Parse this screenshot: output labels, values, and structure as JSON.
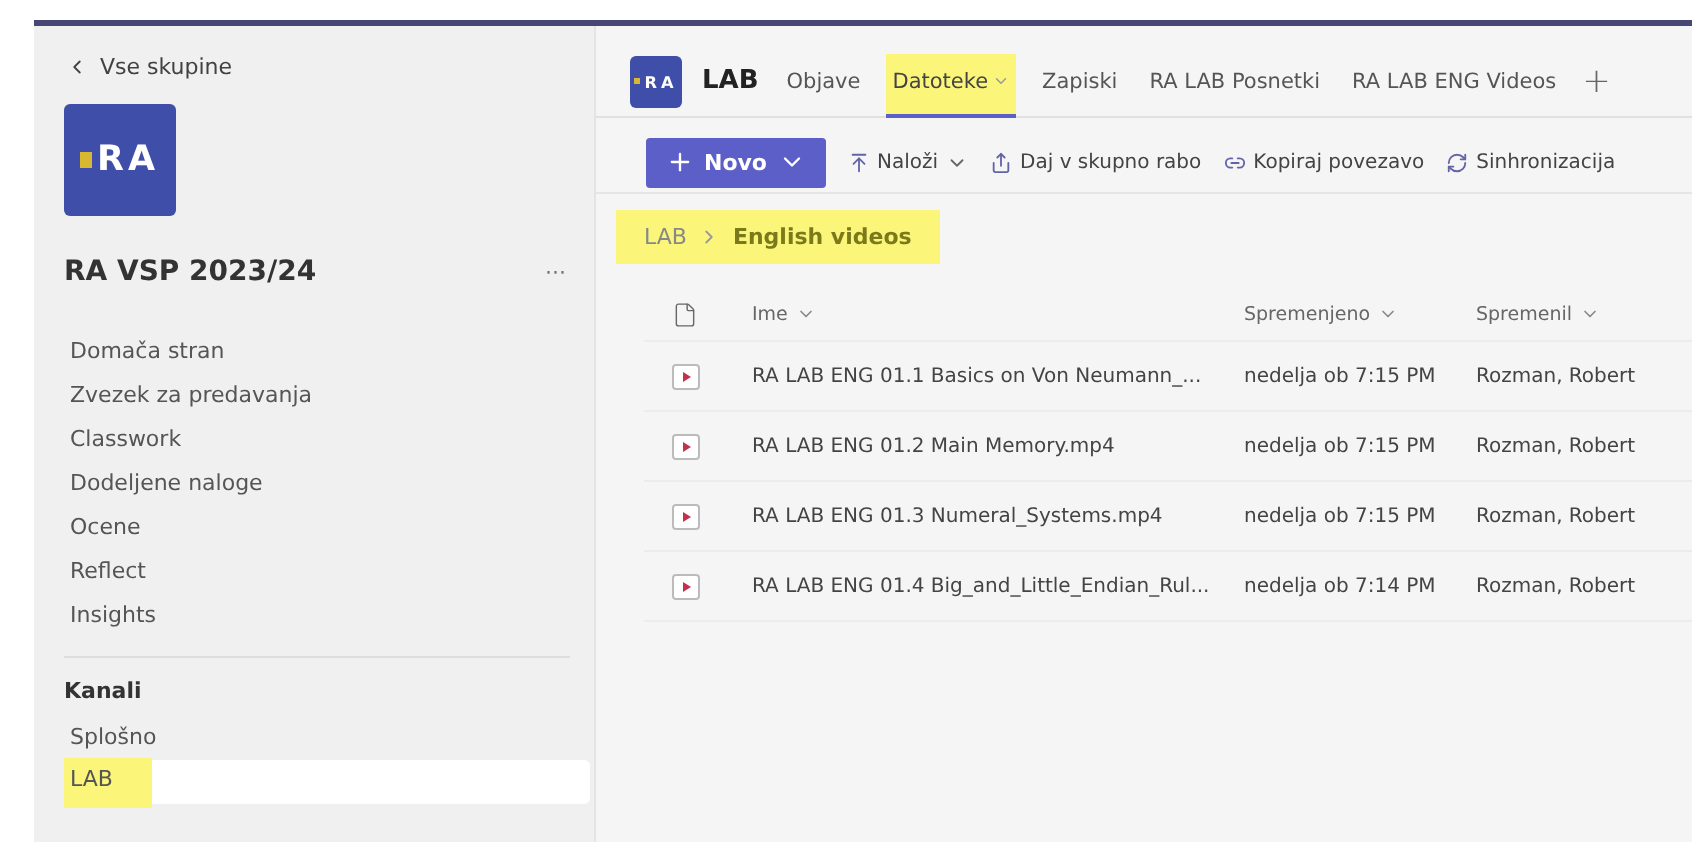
{
  "sidebar": {
    "back_label": "Vse skupine",
    "team_logo": "RA",
    "team_name": "RA VSP 2023/24",
    "more": "···",
    "items": [
      {
        "label": "Domača stran",
        "selected": false
      },
      {
        "label": "Zvezek za predavanja",
        "selected": false
      },
      {
        "label": "Classwork",
        "selected": false
      },
      {
        "label": "Dodeljene naloge",
        "selected": false
      },
      {
        "label": "Ocene",
        "selected": false
      },
      {
        "label": "Reflect",
        "selected": false
      },
      {
        "label": "Insights",
        "selected": false
      }
    ],
    "channels_heading": "Kanali",
    "channels": [
      {
        "label": "Splošno",
        "selected": false,
        "highlighted": false
      },
      {
        "label": "LAB",
        "selected": true,
        "highlighted": true
      }
    ]
  },
  "header": {
    "logo": "RA",
    "channel": "LAB",
    "tabs": [
      {
        "label": "Objave",
        "selected": false,
        "highlighted": false,
        "dropdown": false
      },
      {
        "label": "Datoteke",
        "selected": true,
        "highlighted": true,
        "dropdown": true
      },
      {
        "label": "Zapiski",
        "selected": false,
        "highlighted": false,
        "dropdown": false
      },
      {
        "label": "RA LAB Posnetki",
        "selected": false,
        "highlighted": false,
        "dropdown": false
      },
      {
        "label": "RA LAB ENG Videos",
        "selected": false,
        "highlighted": false,
        "dropdown": false
      }
    ],
    "add": "+"
  },
  "toolbar": [
    {
      "kind": "primary",
      "label": "Novo",
      "dropdown": true
    },
    {
      "kind": "plain",
      "label": "Naloži",
      "dropdown": true
    },
    {
      "kind": "plain",
      "label": "Daj v skupno rabo",
      "dropdown": false
    },
    {
      "kind": "plain",
      "label": "Kopiraj povezavo",
      "dropdown": false
    },
    {
      "kind": "plain",
      "label": "Sinhronizacija",
      "dropdown": false
    }
  ],
  "breadcrumb": {
    "highlighted": true,
    "items": [
      "LAB",
      "English videos"
    ]
  },
  "table": {
    "columns": [
      "Ime",
      "Spremenjeno",
      "Spremenil"
    ],
    "rows": [
      [
        "RA LAB ENG 01.1 Basics on Von Neumann_...",
        "nedelja ob 7:15 PM",
        "Rozman, Robert"
      ],
      [
        "RA LAB ENG 01.2 Main Memory.mp4",
        "nedelja ob 7:15 PM",
        "Rozman, Robert"
      ],
      [
        "RA LAB ENG 01.3 Numeral_Systems.mp4",
        "nedelja ob 7:15 PM",
        "Rozman, Robert"
      ],
      [
        "RA LAB ENG 01.4 Big_and_Little_Endian_Rul...",
        "nedelja ob 7:14 PM",
        "Rozman, Robert"
      ]
    ]
  }
}
